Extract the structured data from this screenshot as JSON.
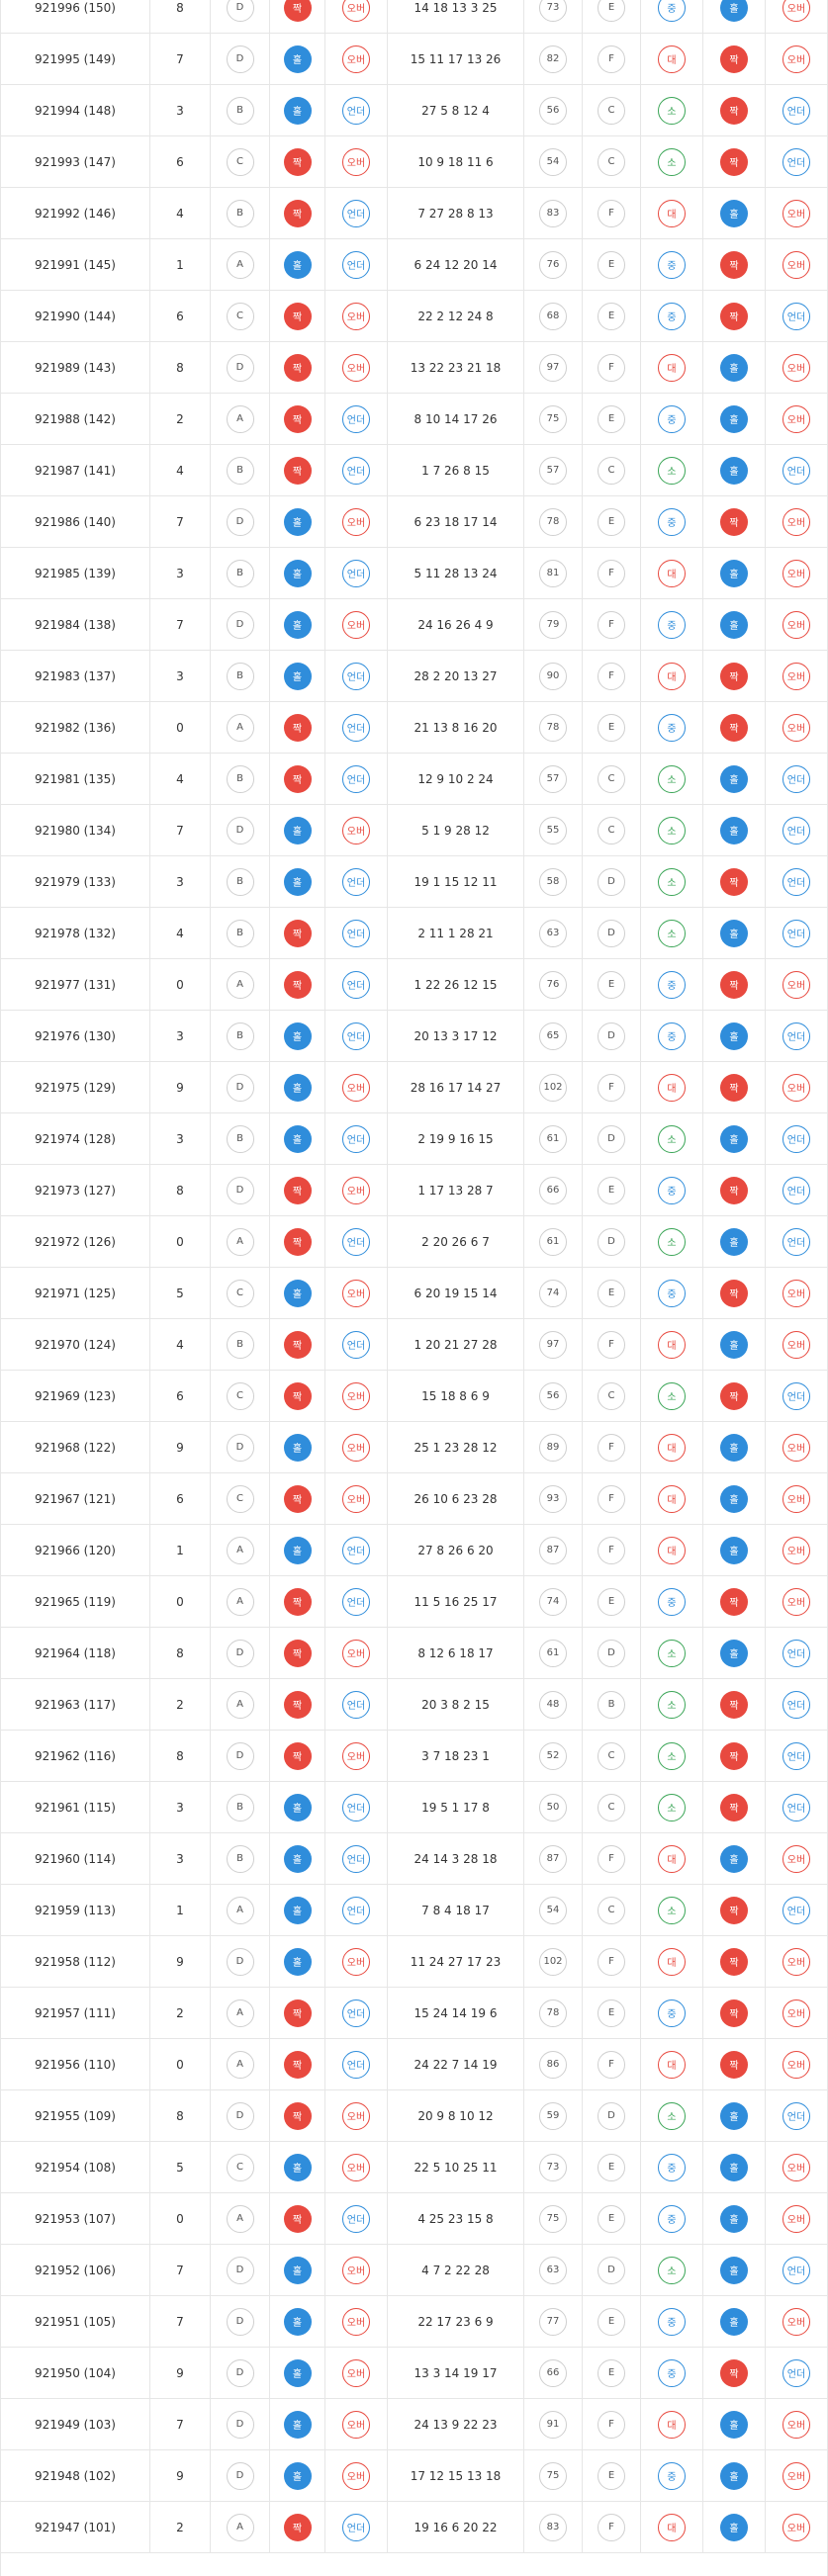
{
  "colors": {
    "red": "#e8493f",
    "blue": "#2f8ddb",
    "green": "#3aa556",
    "grid": "#e6e6e6"
  },
  "rows": [
    {
      "round": "921996 (150)",
      "n": "8",
      "grade": "D",
      "oe": "짝",
      "uo": "오버",
      "nums": "14 18 13 3 25",
      "sum": "73",
      "grade2": "E",
      "size": "중",
      "oe2": "홀",
      "uo2": "오버"
    },
    {
      "round": "921995 (149)",
      "n": "7",
      "grade": "D",
      "oe": "홀",
      "uo": "오버",
      "nums": "15 11 17 13 26",
      "sum": "82",
      "grade2": "F",
      "size": "대",
      "oe2": "짝",
      "uo2": "오버"
    },
    {
      "round": "921994 (148)",
      "n": "3",
      "grade": "B",
      "oe": "홀",
      "uo": "언더",
      "nums": "27 5 8 12 4",
      "sum": "56",
      "grade2": "C",
      "size": "소",
      "oe2": "짝",
      "uo2": "언더"
    },
    {
      "round": "921993 (147)",
      "n": "6",
      "grade": "C",
      "oe": "짝",
      "uo": "오버",
      "nums": "10 9 18 11 6",
      "sum": "54",
      "grade2": "C",
      "size": "소",
      "oe2": "짝",
      "uo2": "언더"
    },
    {
      "round": "921992 (146)",
      "n": "4",
      "grade": "B",
      "oe": "짝",
      "uo": "언더",
      "nums": "7 27 28 8 13",
      "sum": "83",
      "grade2": "F",
      "size": "대",
      "oe2": "홀",
      "uo2": "오버"
    },
    {
      "round": "921991 (145)",
      "n": "1",
      "grade": "A",
      "oe": "홀",
      "uo": "언더",
      "nums": "6 24 12 20 14",
      "sum": "76",
      "grade2": "E",
      "size": "중",
      "oe2": "짝",
      "uo2": "오버"
    },
    {
      "round": "921990 (144)",
      "n": "6",
      "grade": "C",
      "oe": "짝",
      "uo": "오버",
      "nums": "22 2 12 24 8",
      "sum": "68",
      "grade2": "E",
      "size": "중",
      "oe2": "짝",
      "uo2": "언더"
    },
    {
      "round": "921989 (143)",
      "n": "8",
      "grade": "D",
      "oe": "짝",
      "uo": "오버",
      "nums": "13 22 23 21 18",
      "sum": "97",
      "grade2": "F",
      "size": "대",
      "oe2": "홀",
      "uo2": "오버"
    },
    {
      "round": "921988 (142)",
      "n": "2",
      "grade": "A",
      "oe": "짝",
      "uo": "언더",
      "nums": "8 10 14 17 26",
      "sum": "75",
      "grade2": "E",
      "size": "중",
      "oe2": "홀",
      "uo2": "오버"
    },
    {
      "round": "921987 (141)",
      "n": "4",
      "grade": "B",
      "oe": "짝",
      "uo": "언더",
      "nums": "1 7 26 8 15",
      "sum": "57",
      "grade2": "C",
      "size": "소",
      "oe2": "홀",
      "uo2": "언더"
    },
    {
      "round": "921986 (140)",
      "n": "7",
      "grade": "D",
      "oe": "홀",
      "uo": "오버",
      "nums": "6 23 18 17 14",
      "sum": "78",
      "grade2": "E",
      "size": "중",
      "oe2": "짝",
      "uo2": "오버"
    },
    {
      "round": "921985 (139)",
      "n": "3",
      "grade": "B",
      "oe": "홀",
      "uo": "언더",
      "nums": "5 11 28 13 24",
      "sum": "81",
      "grade2": "F",
      "size": "대",
      "oe2": "홀",
      "uo2": "오버"
    },
    {
      "round": "921984 (138)",
      "n": "7",
      "grade": "D",
      "oe": "홀",
      "uo": "오버",
      "nums": "24 16 26 4 9",
      "sum": "79",
      "grade2": "F",
      "size": "중",
      "oe2": "홀",
      "uo2": "오버"
    },
    {
      "round": "921983 (137)",
      "n": "3",
      "grade": "B",
      "oe": "홀",
      "uo": "언더",
      "nums": "28 2 20 13 27",
      "sum": "90",
      "grade2": "F",
      "size": "대",
      "oe2": "짝",
      "uo2": "오버"
    },
    {
      "round": "921982 (136)",
      "n": "0",
      "grade": "A",
      "oe": "짝",
      "uo": "언더",
      "nums": "21 13 8 16 20",
      "sum": "78",
      "grade2": "E",
      "size": "중",
      "oe2": "짝",
      "uo2": "오버"
    },
    {
      "round": "921981 (135)",
      "n": "4",
      "grade": "B",
      "oe": "짝",
      "uo": "언더",
      "nums": "12 9 10 2 24",
      "sum": "57",
      "grade2": "C",
      "size": "소",
      "oe2": "홀",
      "uo2": "언더"
    },
    {
      "round": "921980 (134)",
      "n": "7",
      "grade": "D",
      "oe": "홀",
      "uo": "오버",
      "nums": "5 1 9 28 12",
      "sum": "55",
      "grade2": "C",
      "size": "소",
      "oe2": "홀",
      "uo2": "언더"
    },
    {
      "round": "921979 (133)",
      "n": "3",
      "grade": "B",
      "oe": "홀",
      "uo": "언더",
      "nums": "19 1 15 12 11",
      "sum": "58",
      "grade2": "D",
      "size": "소",
      "oe2": "짝",
      "uo2": "언더"
    },
    {
      "round": "921978 (132)",
      "n": "4",
      "grade": "B",
      "oe": "짝",
      "uo": "언더",
      "nums": "2 11 1 28 21",
      "sum": "63",
      "grade2": "D",
      "size": "소",
      "oe2": "홀",
      "uo2": "언더"
    },
    {
      "round": "921977 (131)",
      "n": "0",
      "grade": "A",
      "oe": "짝",
      "uo": "언더",
      "nums": "1 22 26 12 15",
      "sum": "76",
      "grade2": "E",
      "size": "중",
      "oe2": "짝",
      "uo2": "오버"
    },
    {
      "round": "921976 (130)",
      "n": "3",
      "grade": "B",
      "oe": "홀",
      "uo": "언더",
      "nums": "20 13 3 17 12",
      "sum": "65",
      "grade2": "D",
      "size": "중",
      "oe2": "홀",
      "uo2": "언더"
    },
    {
      "round": "921975 (129)",
      "n": "9",
      "grade": "D",
      "oe": "홀",
      "uo": "오버",
      "nums": "28 16 17 14 27",
      "sum": "102",
      "grade2": "F",
      "size": "대",
      "oe2": "짝",
      "uo2": "오버"
    },
    {
      "round": "921974 (128)",
      "n": "3",
      "grade": "B",
      "oe": "홀",
      "uo": "언더",
      "nums": "2 19 9 16 15",
      "sum": "61",
      "grade2": "D",
      "size": "소",
      "oe2": "홀",
      "uo2": "언더"
    },
    {
      "round": "921973 (127)",
      "n": "8",
      "grade": "D",
      "oe": "짝",
      "uo": "오버",
      "nums": "1 17 13 28 7",
      "sum": "66",
      "grade2": "E",
      "size": "중",
      "oe2": "짝",
      "uo2": "언더"
    },
    {
      "round": "921972 (126)",
      "n": "0",
      "grade": "A",
      "oe": "짝",
      "uo": "언더",
      "nums": "2 20 26 6 7",
      "sum": "61",
      "grade2": "D",
      "size": "소",
      "oe2": "홀",
      "uo2": "언더"
    },
    {
      "round": "921971 (125)",
      "n": "5",
      "grade": "C",
      "oe": "홀",
      "uo": "오버",
      "nums": "6 20 19 15 14",
      "sum": "74",
      "grade2": "E",
      "size": "중",
      "oe2": "짝",
      "uo2": "오버"
    },
    {
      "round": "921970 (124)",
      "n": "4",
      "grade": "B",
      "oe": "짝",
      "uo": "언더",
      "nums": "1 20 21 27 28",
      "sum": "97",
      "grade2": "F",
      "size": "대",
      "oe2": "홀",
      "uo2": "오버"
    },
    {
      "round": "921969 (123)",
      "n": "6",
      "grade": "C",
      "oe": "짝",
      "uo": "오버",
      "nums": "15 18 8 6 9",
      "sum": "56",
      "grade2": "C",
      "size": "소",
      "oe2": "짝",
      "uo2": "언더"
    },
    {
      "round": "921968 (122)",
      "n": "9",
      "grade": "D",
      "oe": "홀",
      "uo": "오버",
      "nums": "25 1 23 28 12",
      "sum": "89",
      "grade2": "F",
      "size": "대",
      "oe2": "홀",
      "uo2": "오버"
    },
    {
      "round": "921967 (121)",
      "n": "6",
      "grade": "C",
      "oe": "짝",
      "uo": "오버",
      "nums": "26 10 6 23 28",
      "sum": "93",
      "grade2": "F",
      "size": "대",
      "oe2": "홀",
      "uo2": "오버"
    },
    {
      "round": "921966 (120)",
      "n": "1",
      "grade": "A",
      "oe": "홀",
      "uo": "언더",
      "nums": "27 8 26 6 20",
      "sum": "87",
      "grade2": "F",
      "size": "대",
      "oe2": "홀",
      "uo2": "오버"
    },
    {
      "round": "921965 (119)",
      "n": "0",
      "grade": "A",
      "oe": "짝",
      "uo": "언더",
      "nums": "11 5 16 25 17",
      "sum": "74",
      "grade2": "E",
      "size": "중",
      "oe2": "짝",
      "uo2": "오버"
    },
    {
      "round": "921964 (118)",
      "n": "8",
      "grade": "D",
      "oe": "짝",
      "uo": "오버",
      "nums": "8 12 6 18 17",
      "sum": "61",
      "grade2": "D",
      "size": "소",
      "oe2": "홀",
      "uo2": "언더"
    },
    {
      "round": "921963 (117)",
      "n": "2",
      "grade": "A",
      "oe": "짝",
      "uo": "언더",
      "nums": "20 3 8 2 15",
      "sum": "48",
      "grade2": "B",
      "size": "소",
      "oe2": "짝",
      "uo2": "언더"
    },
    {
      "round": "921962 (116)",
      "n": "8",
      "grade": "D",
      "oe": "짝",
      "uo": "오버",
      "nums": "3 7 18 23 1",
      "sum": "52",
      "grade2": "C",
      "size": "소",
      "oe2": "짝",
      "uo2": "언더"
    },
    {
      "round": "921961 (115)",
      "n": "3",
      "grade": "B",
      "oe": "홀",
      "uo": "언더",
      "nums": "19 5 1 17 8",
      "sum": "50",
      "grade2": "C",
      "size": "소",
      "oe2": "짝",
      "uo2": "언더"
    },
    {
      "round": "921960 (114)",
      "n": "3",
      "grade": "B",
      "oe": "홀",
      "uo": "언더",
      "nums": "24 14 3 28 18",
      "sum": "87",
      "grade2": "F",
      "size": "대",
      "oe2": "홀",
      "uo2": "오버"
    },
    {
      "round": "921959 (113)",
      "n": "1",
      "grade": "A",
      "oe": "홀",
      "uo": "언더",
      "nums": "7 8 4 18 17",
      "sum": "54",
      "grade2": "C",
      "size": "소",
      "oe2": "짝",
      "uo2": "언더"
    },
    {
      "round": "921958 (112)",
      "n": "9",
      "grade": "D",
      "oe": "홀",
      "uo": "오버",
      "nums": "11 24 27 17 23",
      "sum": "102",
      "grade2": "F",
      "size": "대",
      "oe2": "짝",
      "uo2": "오버"
    },
    {
      "round": "921957 (111)",
      "n": "2",
      "grade": "A",
      "oe": "짝",
      "uo": "언더",
      "nums": "15 24 14 19 6",
      "sum": "78",
      "grade2": "E",
      "size": "중",
      "oe2": "짝",
      "uo2": "오버"
    },
    {
      "round": "921956 (110)",
      "n": "0",
      "grade": "A",
      "oe": "짝",
      "uo": "언더",
      "nums": "24 22 7 14 19",
      "sum": "86",
      "grade2": "F",
      "size": "대",
      "oe2": "짝",
      "uo2": "오버"
    },
    {
      "round": "921955 (109)",
      "n": "8",
      "grade": "D",
      "oe": "짝",
      "uo": "오버",
      "nums": "20 9 8 10 12",
      "sum": "59",
      "grade2": "D",
      "size": "소",
      "oe2": "홀",
      "uo2": "언더"
    },
    {
      "round": "921954 (108)",
      "n": "5",
      "grade": "C",
      "oe": "홀",
      "uo": "오버",
      "nums": "22 5 10 25 11",
      "sum": "73",
      "grade2": "E",
      "size": "중",
      "oe2": "홀",
      "uo2": "오버"
    },
    {
      "round": "921953 (107)",
      "n": "0",
      "grade": "A",
      "oe": "짝",
      "uo": "언더",
      "nums": "4 25 23 15 8",
      "sum": "75",
      "grade2": "E",
      "size": "중",
      "oe2": "홀",
      "uo2": "오버"
    },
    {
      "round": "921952 (106)",
      "n": "7",
      "grade": "D",
      "oe": "홀",
      "uo": "오버",
      "nums": "4 7 2 22 28",
      "sum": "63",
      "grade2": "D",
      "size": "소",
      "oe2": "홀",
      "uo2": "언더"
    },
    {
      "round": "921951 (105)",
      "n": "7",
      "grade": "D",
      "oe": "홀",
      "uo": "오버",
      "nums": "22 17 23 6 9",
      "sum": "77",
      "grade2": "E",
      "size": "중",
      "oe2": "홀",
      "uo2": "오버"
    },
    {
      "round": "921950 (104)",
      "n": "9",
      "grade": "D",
      "oe": "홀",
      "uo": "오버",
      "nums": "13 3 14 19 17",
      "sum": "66",
      "grade2": "E",
      "size": "중",
      "oe2": "짝",
      "uo2": "언더"
    },
    {
      "round": "921949 (103)",
      "n": "7",
      "grade": "D",
      "oe": "홀",
      "uo": "오버",
      "nums": "24 13 9 22 23",
      "sum": "91",
      "grade2": "F",
      "size": "대",
      "oe2": "홀",
      "uo2": "오버"
    },
    {
      "round": "921948 (102)",
      "n": "9",
      "grade": "D",
      "oe": "홀",
      "uo": "오버",
      "nums": "17 12 15 13 18",
      "sum": "75",
      "grade2": "E",
      "size": "중",
      "oe2": "홀",
      "uo2": "오버"
    },
    {
      "round": "921947 (101)",
      "n": "2",
      "grade": "A",
      "oe": "짝",
      "uo": "언더",
      "nums": "19 16 6 20 22",
      "sum": "83",
      "grade2": "F",
      "size": "대",
      "oe2": "홀",
      "uo2": "오버"
    }
  ]
}
